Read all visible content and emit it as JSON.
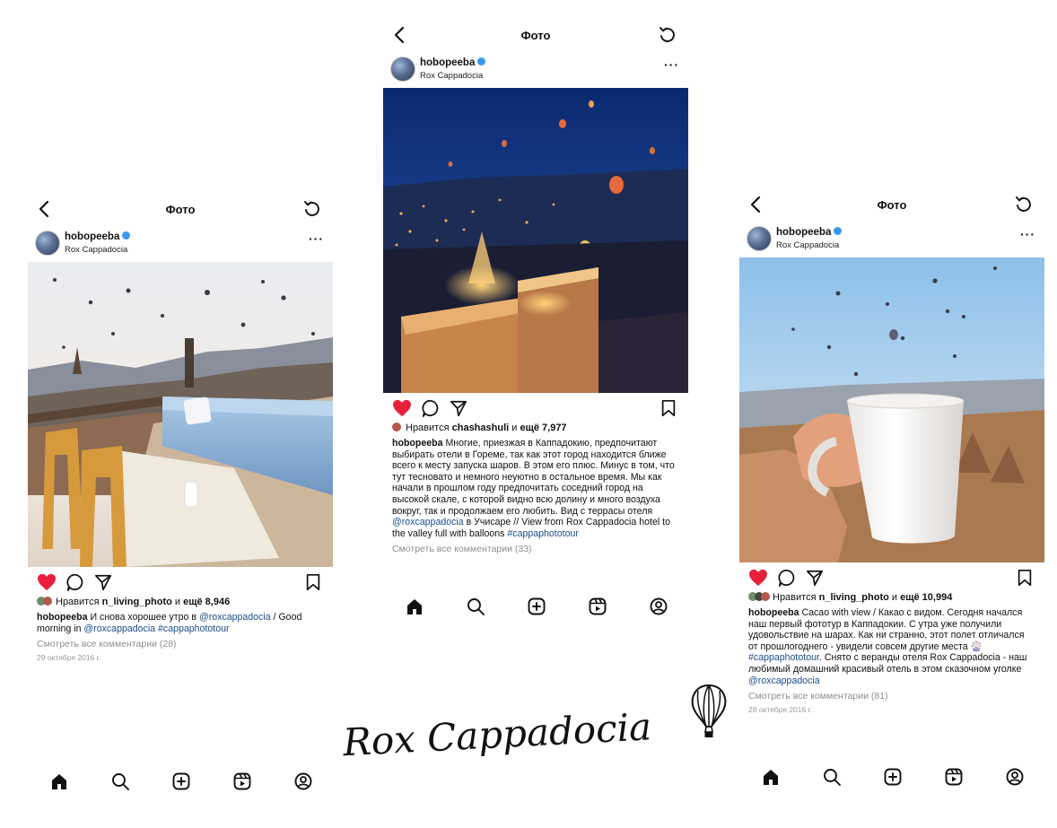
{
  "screens": [
    {
      "header_title": "Фото",
      "username": "hobopeeba",
      "location": "Rox Cappadocia",
      "liked_by_prefix": "Нравится ",
      "liked_by_user": "n_living_photo",
      "liked_by_mid": " и ",
      "liked_by_count": "ещё 8,946",
      "caption_parts": [
        {
          "type": "user",
          "text": "hobopeeba"
        },
        {
          "type": "text",
          "text": " И снова хорошее утро в "
        },
        {
          "type": "link",
          "text": "@roxcappadocia"
        },
        {
          "type": "text",
          "text": " / Good morning in "
        },
        {
          "type": "link",
          "text": "@roxcappadocia"
        },
        {
          "type": "text",
          "text": " "
        },
        {
          "type": "link",
          "text": "#cappaphototour"
        }
      ],
      "view_comments": "Смотреть все комментарии (28)",
      "date": "29 октября 2016 г."
    },
    {
      "header_title": "Фото",
      "username": "hobopeeba",
      "location": "Rox Cappadocia",
      "liked_by_prefix": "Нравится ",
      "liked_by_user": "chashashuli",
      "liked_by_mid": " и ",
      "liked_by_count": "ещё 7,977",
      "caption_parts": [
        {
          "type": "user",
          "text": "hobopeeba"
        },
        {
          "type": "text",
          "text": " Многие, приезжая в Каппадокию, предпочитают выбирать отели в Гореме, так как этот город находится ближе всего к месту запуска шаров. В этом его плюс. Минус в том, что тут тесновато и немного неуютно в остальное время. Мы как начали в прошлом году предпочитать соседний город на высокой скале, с которой видно всю долину и много воздуха вокруг, так и продолжаем его любить. Вид с террасы отеля "
        },
        {
          "type": "link",
          "text": "@roxcappadocia"
        },
        {
          "type": "text",
          "text": " в Учисаре // View from Rox Cappadocia hotel to the valley full with balloons "
        },
        {
          "type": "link",
          "text": "#cappaphototour"
        }
      ],
      "view_comments": "Смотреть все комментарии (33)",
      "date": ""
    },
    {
      "header_title": "Фото",
      "username": "hobopeeba",
      "location": "Rox Cappadocia",
      "liked_by_prefix": "Нравится ",
      "liked_by_user": "n_living_photo",
      "liked_by_mid": " и ",
      "liked_by_count": "ещё 10,994",
      "caption_parts": [
        {
          "type": "user",
          "text": "hobopeeba"
        },
        {
          "type": "text",
          "text": " Cacao with view / Какао с видом. Сегодня начался наш первый фототур в Каппадокии. С утра уже получили удовольствие на шарах. Как ни странно, этот полет отличался от прошлогоднего - увидели совсем другие места 🎡 "
        },
        {
          "type": "link",
          "text": "#cappaphototour"
        },
        {
          "type": "text",
          "text": ". Снято с веранды отеля Rox Cappadocia - наш любимый домашний красивый отель в этом сказочном уголке "
        },
        {
          "type": "link",
          "text": "@roxcappadocia"
        }
      ],
      "view_comments": "Смотреть все комментарии (81)",
      "date": "28 октября 2016 г."
    }
  ],
  "brand_text": "Rox Cappadocia",
  "colors": {
    "heart": "#e8203c",
    "link": "#1a4d8a",
    "verified": "#3897f0",
    "muted": "#8e8e8e"
  },
  "icons": {
    "header": [
      "back-arrow-icon",
      "refresh-icon",
      "more-dots-icon",
      "verified-badge-icon"
    ],
    "actions": [
      "heart-filled-icon",
      "comment-icon",
      "share-icon",
      "bookmark-icon"
    ],
    "nav": [
      "home-icon",
      "search-icon",
      "add-post-icon",
      "reels-icon",
      "profile-icon"
    ],
    "decor": [
      "hot-air-balloon-icon"
    ]
  }
}
